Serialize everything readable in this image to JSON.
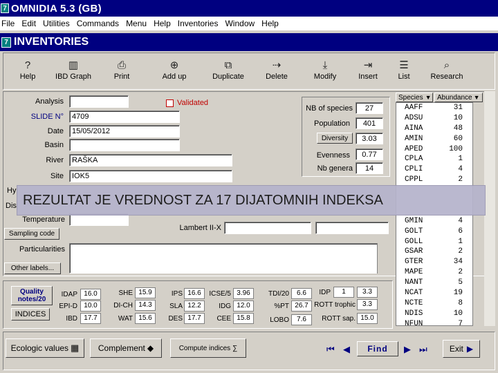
{
  "window": {
    "app_title": "OMNIDIA 5.3 (GB)",
    "icon_letter": "7"
  },
  "menu": [
    "File",
    "Edit",
    "Utilities",
    "Commands",
    "Menu",
    "Help",
    "Inventories",
    "Window",
    "Help"
  ],
  "subwindow": {
    "title": "INVENTORIES",
    "icon_letter": "7"
  },
  "toolbar": [
    {
      "label": "Help",
      "icon": "question-icon"
    },
    {
      "label": "IBD Graph",
      "icon": "bar-chart-icon"
    },
    {
      "label": "Print",
      "icon": "printer-icon"
    },
    {
      "label": "Add up",
      "icon": "add-icon"
    },
    {
      "label": "Duplicate",
      "icon": "duplicate-icon"
    },
    {
      "label": "Delete",
      "icon": "delete-icon"
    },
    {
      "label": "Modify",
      "icon": "modify-icon"
    },
    {
      "label": "Insert",
      "icon": "insert-icon"
    },
    {
      "label": "List",
      "icon": "list-icon"
    },
    {
      "label": "Research",
      "icon": "research-icon"
    }
  ],
  "form": {
    "analysis_label": "Analysis",
    "analysis_value": "",
    "validated_label": "Validated",
    "slide_label": "SLIDE N°",
    "slide_value": "4709",
    "date_label": "Date",
    "date_value": "15/05/2012",
    "basin_label": "Basin",
    "basin_value": "",
    "river_label": "River",
    "river_value": "RAŠKA",
    "site_label": "Site",
    "site_value": "IOK5",
    "hy_label": "Hy",
    "dis_label": "Dis",
    "temperature_label": "Temperature",
    "temperature_value": "",
    "sampling_button": "Sampling code",
    "lambert_label": "Lambert II-X",
    "lambert_value": "",
    "particularities_label": "Particularities",
    "particularities_value": "",
    "other_labels_button": "Other labels..."
  },
  "stats": {
    "nb_species_label": "NB of species",
    "nb_species_value": "27",
    "population_label": "Population",
    "population_value": "401",
    "diversity_button": "Diversity",
    "diversity_value": "3.03",
    "evenness_label": "Evenness",
    "evenness_value": "0.77",
    "nb_genera_label": "Nb genera",
    "nb_genera_value": "14"
  },
  "species_header": {
    "species": "Species",
    "abundance": "Abundance"
  },
  "species": [
    {
      "code": "AAFF",
      "n": "31"
    },
    {
      "code": "ADSU",
      "n": "10"
    },
    {
      "code": "AINA",
      "n": "48"
    },
    {
      "code": "AMIN",
      "n": "60"
    },
    {
      "code": "APED",
      "n": "100"
    },
    {
      "code": "CPLA",
      "n": "1"
    },
    {
      "code": "CPLI",
      "n": "4"
    },
    {
      "code": "CPPL",
      "n": "2"
    },
    {
      "code": "",
      "n": ""
    },
    {
      "code": "",
      "n": ""
    },
    {
      "code": "",
      "n": ""
    },
    {
      "code": "GMIN",
      "n": "4"
    },
    {
      "code": "GOLT",
      "n": "6"
    },
    {
      "code": "GOLL",
      "n": "1"
    },
    {
      "code": "GSAR",
      "n": "2"
    },
    {
      "code": "GTER",
      "n": "34"
    },
    {
      "code": "MAPE",
      "n": "2"
    },
    {
      "code": "NANT",
      "n": "5"
    },
    {
      "code": "NCAT",
      "n": "19"
    },
    {
      "code": "NCTE",
      "n": "8"
    },
    {
      "code": "NDIS",
      "n": "10"
    },
    {
      "code": "NFUN",
      "n": "7"
    }
  ],
  "overlay_text": "REZULTAT JE VREDNOST ZA 17 DIJATOMNIH INDEKSA",
  "indices_panel": {
    "quality_label": "Quality notes/20",
    "indices_button": "INDICES"
  },
  "indices": [
    {
      "label": "IDAP",
      "value": "16.0"
    },
    {
      "label": "EPI-D",
      "value": "10.0"
    },
    {
      "label": "IBD",
      "value": "17.7"
    },
    {
      "label": "SHE",
      "value": "15.9"
    },
    {
      "label": "DI-CH",
      "value": "14.3"
    },
    {
      "label": "WAT",
      "value": "15.6"
    },
    {
      "label": "IPS",
      "value": "16.6"
    },
    {
      "label": "SLA",
      "value": "12.2"
    },
    {
      "label": "DES",
      "value": "17.7"
    },
    {
      "label": "ICSE/5",
      "value": "3.96"
    },
    {
      "label": "IDG",
      "value": "12.0"
    },
    {
      "label": "CEE",
      "value": "15.8"
    },
    {
      "label": "TDI/20",
      "value": "6.6"
    },
    {
      "label": "%PT",
      "value": "26.7"
    },
    {
      "label": "LOBO",
      "value": "7.6"
    },
    {
      "label": "IDP",
      "value": "1"
    },
    {
      "label": "ROTT trophic",
      "value": "3.3"
    },
    {
      "label": "ROTT sap.",
      "value": "15.0"
    }
  ],
  "idp_extra": "3.3",
  "bottom": {
    "ecological_values": "Ecologic values",
    "complement": "Complement",
    "compute_indices": "Compute indices",
    "find": "Find",
    "exit": "Exit"
  }
}
